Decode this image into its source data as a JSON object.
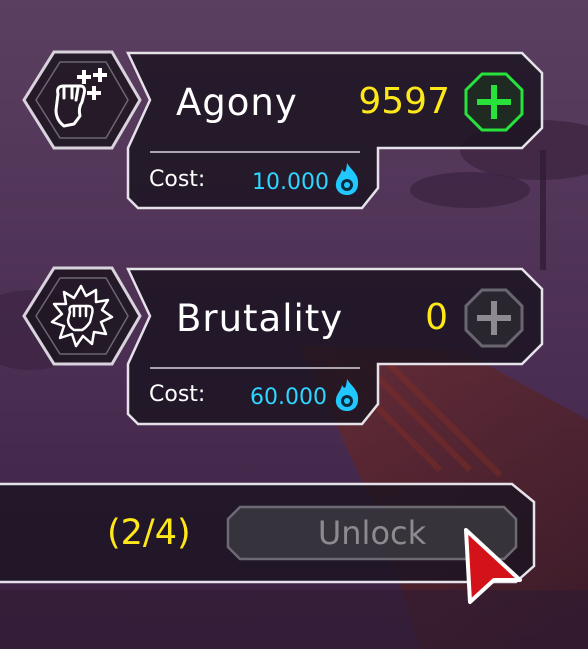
{
  "skills": [
    {
      "name": "Agony",
      "count": "9597",
      "cost_label": "Cost:",
      "cost_value": "10.000",
      "icon": "fist-plus-icon",
      "can_upgrade": true
    },
    {
      "name": "Brutality",
      "count": "0",
      "cost_label": "Cost:",
      "cost_value": "60.000",
      "icon": "fist-impact-icon",
      "can_upgrade": false
    }
  ],
  "unlock": {
    "progress": "(2/4)",
    "label": "Unlock",
    "enabled": false
  },
  "colors": {
    "accent_yellow": "#ffe81a",
    "cost_cyan": "#2fd6ff",
    "plus_green": "#27e23a",
    "cursor_red": "#d4121a"
  }
}
